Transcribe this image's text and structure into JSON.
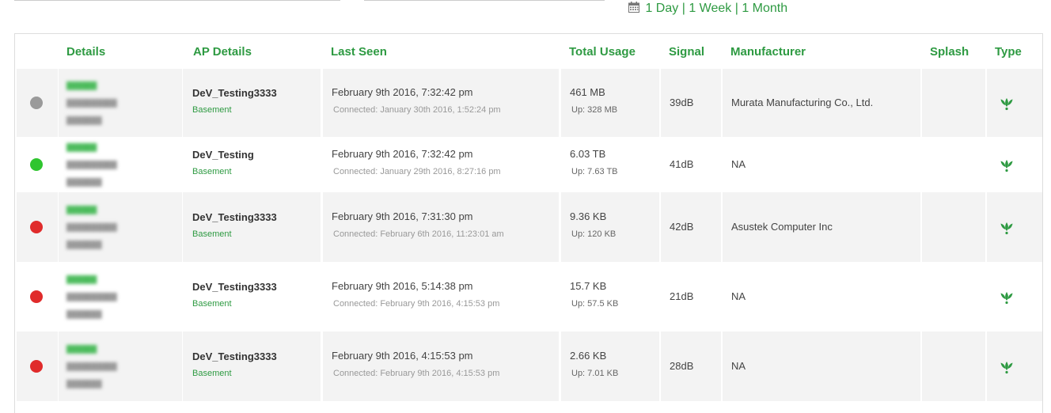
{
  "range_links": {
    "day": "1 Day",
    "week": "1 Week",
    "month": "1 Month",
    "separator": "|"
  },
  "colors": {
    "accent": "#2e9a42",
    "status_gray": "#9a9a9a",
    "status_green": "#2fc52f",
    "status_red": "#e02b2b"
  },
  "headers": {
    "details": "Details",
    "ap_details": "AP Details",
    "last_seen": "Last Seen",
    "total_usage": "Total Usage",
    "signal": "Signal",
    "manufacturer": "Manufacturer",
    "splash": "Splash",
    "type": "Type"
  },
  "rows": [
    {
      "status": "gray",
      "ap_name": "DeV_Testing3333",
      "ap_location": "Basement",
      "last_seen": "February 9th 2016, 7:32:42 pm",
      "connected": "Connected: January 30th 2016, 1:52:24 pm",
      "total": "461 MB",
      "up": "Up: 328 MB",
      "signal": "39dB",
      "manufacturer": "Murata Manufacturing Co., Ltd.",
      "type_icon": "leaf-icon"
    },
    {
      "status": "green",
      "ap_name": "DeV_Testing",
      "ap_location": "Basement",
      "last_seen": "February 9th 2016, 7:32:42 pm",
      "connected": "Connected: January 29th 2016, 8:27:16 pm",
      "total": "6.03 TB",
      "up": "Up: 7.63 TB",
      "signal": "41dB",
      "manufacturer": "NA",
      "type_icon": "leaf-icon"
    },
    {
      "status": "red",
      "ap_name": "DeV_Testing3333",
      "ap_location": "Basement",
      "last_seen": "February 9th 2016, 7:31:30 pm",
      "connected": "Connected: February 6th 2016, 11:23:01 am",
      "total": "9.36 KB",
      "up": "Up: 120 KB",
      "signal": "42dB",
      "manufacturer": "Asustek Computer Inc",
      "type_icon": "leaf-icon"
    },
    {
      "status": "red",
      "ap_name": "DeV_Testing3333",
      "ap_location": "Basement",
      "last_seen": "February 9th 2016, 5:14:38 pm",
      "connected": "Connected: February 9th 2016, 4:15:53 pm",
      "total": "15.7 KB",
      "up": "Up: 57.5 KB",
      "signal": "21dB",
      "manufacturer": "NA",
      "type_icon": "leaf-icon"
    },
    {
      "status": "red",
      "ap_name": "DeV_Testing3333",
      "ap_location": "Basement",
      "last_seen": "February 9th 2016, 4:15:53 pm",
      "connected": "Connected: February 9th 2016, 4:15:53 pm",
      "total": "2.66 KB",
      "up": "Up: 7.01 KB",
      "signal": "28dB",
      "manufacturer": "NA",
      "type_icon": "leaf-icon"
    }
  ]
}
